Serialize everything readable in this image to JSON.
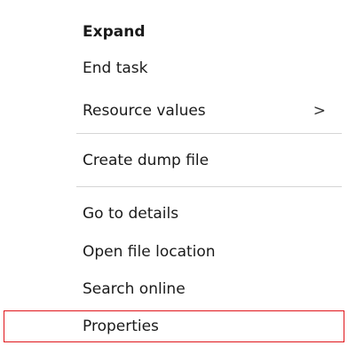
{
  "context_menu": {
    "items": [
      {
        "label": "Expand",
        "bold": true
      },
      {
        "label": "End task"
      },
      {
        "label": "Resource values",
        "submenu_arrow": ">"
      },
      {
        "label": "Create dump file"
      },
      {
        "label": "Go to details"
      },
      {
        "label": "Open file location"
      },
      {
        "label": "Search online"
      },
      {
        "label": "Properties",
        "highlighted": true
      }
    ]
  },
  "colors": {
    "highlight_border": "#e0151a",
    "separator": "#d5d5d5",
    "text": "#1a1a1a"
  }
}
